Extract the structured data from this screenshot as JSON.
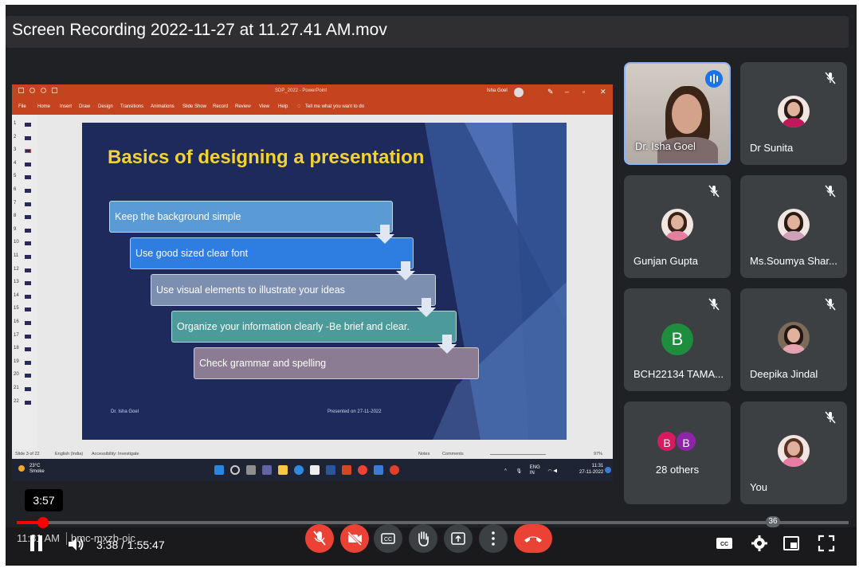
{
  "video": {
    "title": "Screen Recording 2022-11-27 at 11.27.41 AM.mov",
    "hover_time": "3:57",
    "time_display": "3:38 / 1:55:47",
    "progress_fraction": 0.0315
  },
  "powerpoint": {
    "doc_title": "SDP_2022  -  PowerPoint",
    "user": "Isha Goel",
    "menu": [
      "File",
      "Home",
      "Insert",
      "Draw",
      "Design",
      "Transitions",
      "Animations",
      "Slide Show",
      "Record",
      "Review",
      "View",
      "Help"
    ],
    "tell_me": "Tell me what you want to do",
    "thumb_numbers": [
      "1",
      "2",
      "3",
      "4",
      "5",
      "6",
      "7",
      "8",
      "9",
      "10",
      "11",
      "12",
      "13",
      "14",
      "15",
      "16",
      "17",
      "18",
      "19",
      "20",
      "21",
      "22"
    ],
    "status": {
      "slide": "Slide 3 of 22",
      "language": "English (India)",
      "accessibility": "Accessibility: Investigate",
      "notes": "Notes",
      "comments": "Comments",
      "zoom": "97%"
    }
  },
  "slide": {
    "title": "Basics of designing a presentation",
    "steps": [
      "Keep the background simple",
      "Use good sized clear font",
      "Use visual elements to illustrate your ideas",
      "Organize your information clearly -Be brief and clear.",
      "Check grammar and spelling"
    ],
    "author": "Dr. Isha Goel",
    "presented_on": "Presented on 27-11-2022",
    "colors": [
      "#5a9bd5",
      "#2e7de1",
      "#7c8fb0",
      "#4d9a9a",
      "#8b7b93"
    ]
  },
  "taskbar": {
    "temp": "23°C",
    "weather": "Smoke",
    "lang": "ENG",
    "region": "IN",
    "time": "11:31",
    "date": "27-11-2022"
  },
  "participants": [
    {
      "name": "Dr. Isha Goel",
      "muted": false,
      "speaking": true
    },
    {
      "name": "Dr Sunita",
      "muted": true
    },
    {
      "name": "Gunjan Gupta",
      "muted": true
    },
    {
      "name": "Ms.Soumya Shar...",
      "muted": true
    },
    {
      "name": "BCH22134 TAMA...",
      "muted": true,
      "initial": "B"
    },
    {
      "name": "Deepika Jindal",
      "muted": true
    },
    {
      "name": "28 others",
      "initials": [
        "B",
        "B"
      ]
    },
    {
      "name": "You",
      "muted": true
    }
  ],
  "meet": {
    "clock": "11:31 AM",
    "code": "bmc-mxzb-ojc",
    "people_count": "36"
  }
}
